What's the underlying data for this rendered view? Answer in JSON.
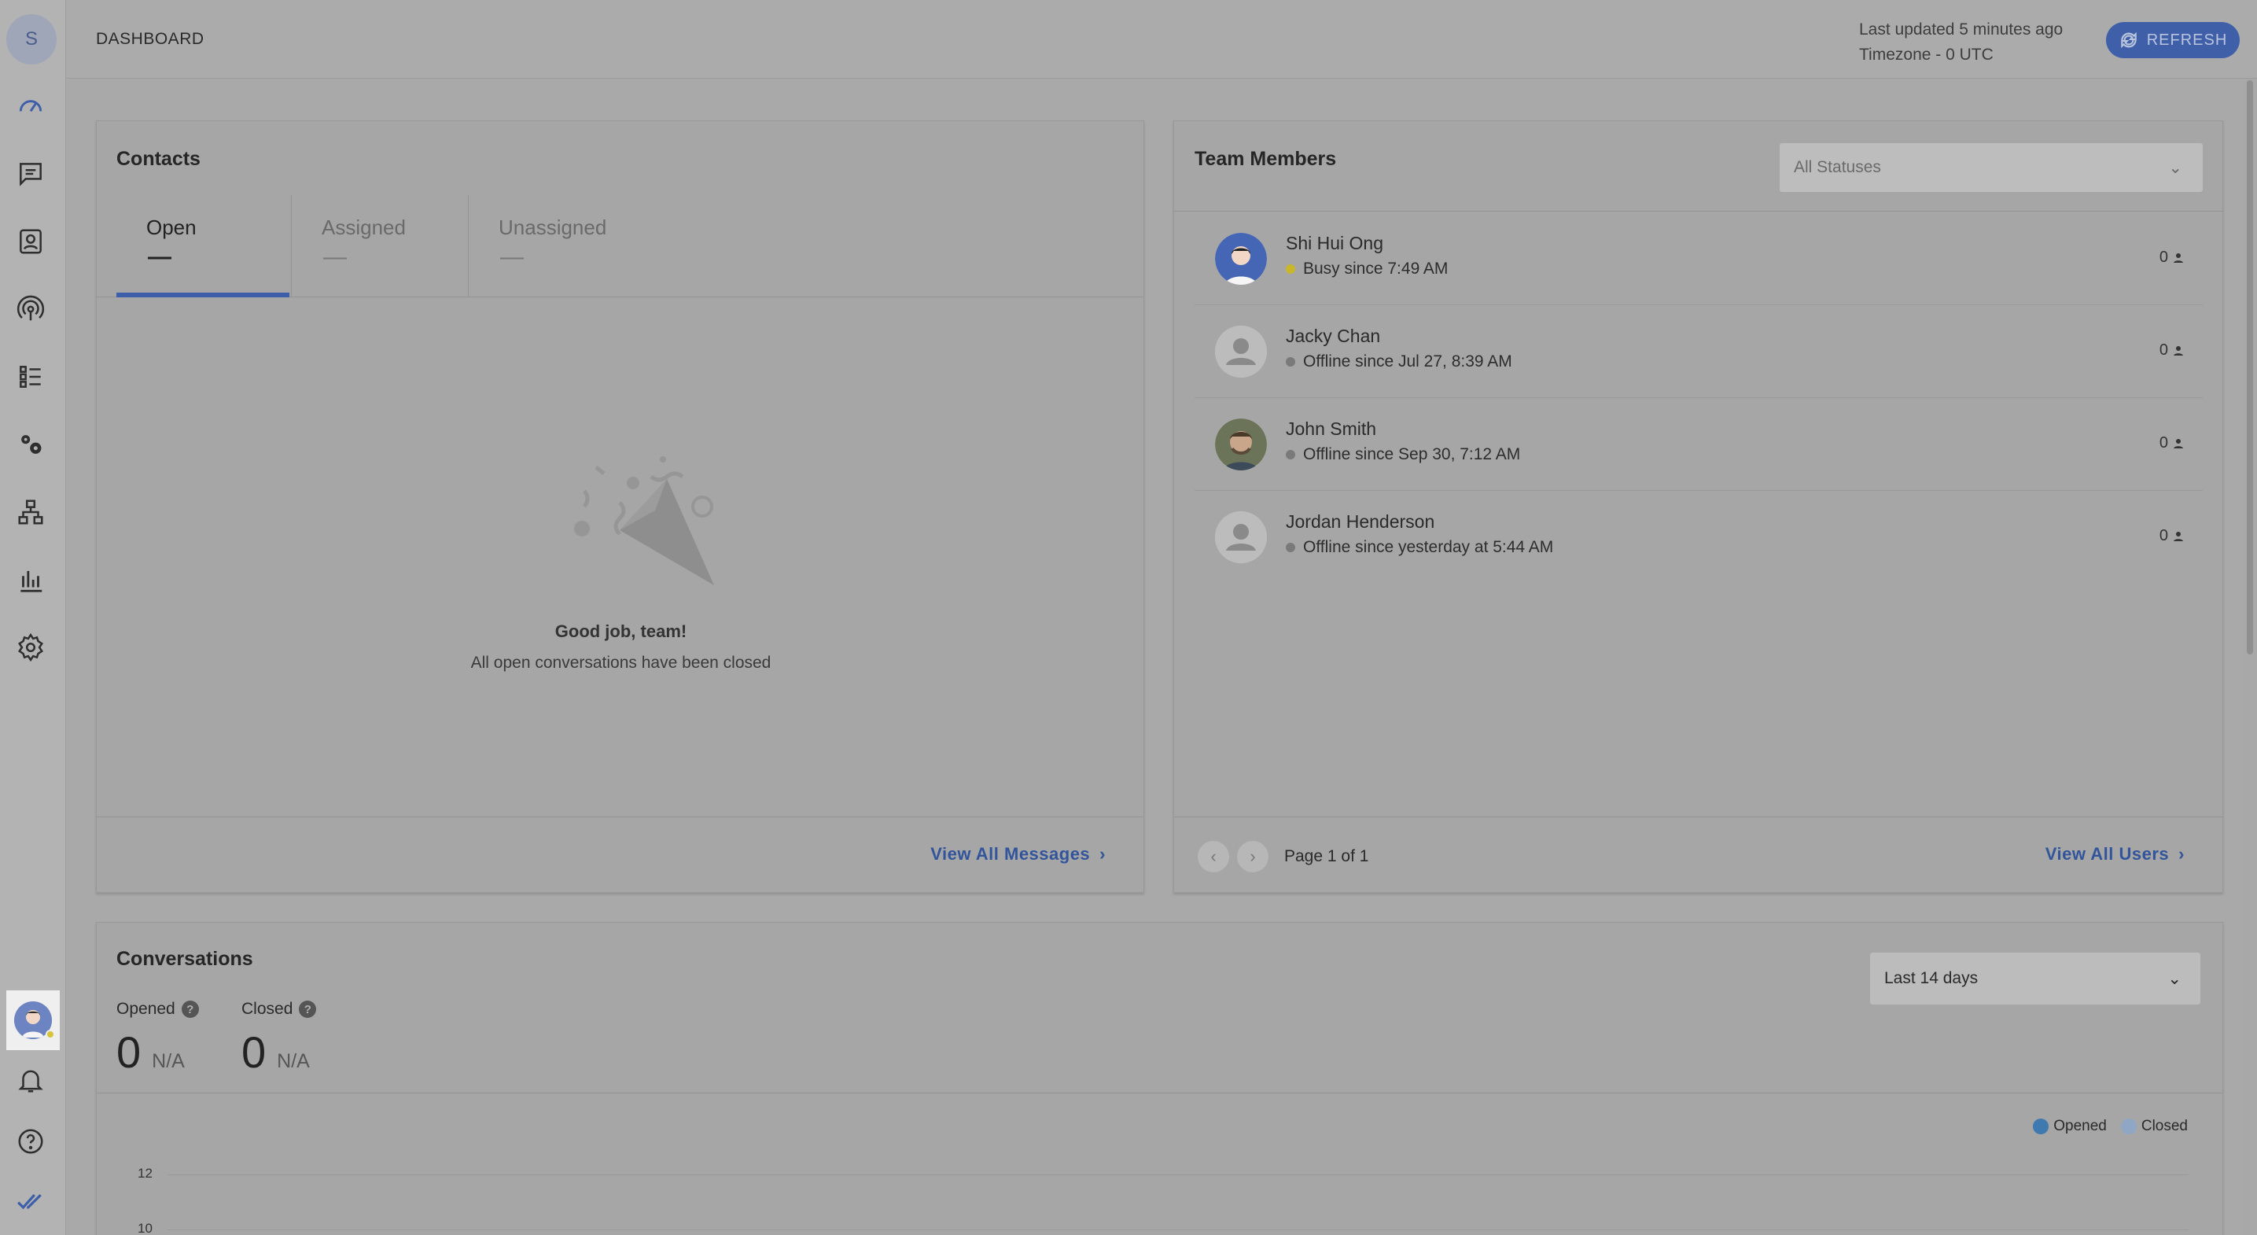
{
  "sidebar": {
    "org_initial": "S",
    "items": [
      "dashboard",
      "messages",
      "contacts",
      "broadcasts",
      "lists",
      "integrations",
      "workflows",
      "reports",
      "settings"
    ]
  },
  "header": {
    "title": "DASHBOARD",
    "last_updated": "Last updated 5 minutes ago",
    "timezone": "Timezone - 0 UTC",
    "refresh_label": "REFRESH"
  },
  "contacts": {
    "title": "Contacts",
    "tabs": [
      {
        "label": "Open",
        "value": "—",
        "active": true
      },
      {
        "label": "Assigned",
        "value": "—",
        "active": false
      },
      {
        "label": "Unassigned",
        "value": "—",
        "active": false
      }
    ],
    "empty_title": "Good job, team!",
    "empty_sub": "All open conversations have been closed",
    "footer_link": "View All Messages"
  },
  "team": {
    "title": "Team Members",
    "status_filter": "All Statuses",
    "members": [
      {
        "name": "Shi Hui Ong",
        "status": "Busy since 7:49 AM",
        "status_color": "#c9b72b",
        "count": "0"
      },
      {
        "name": "Jacky Chan",
        "status": "Offline since Jul 27, 8:39 AM",
        "status_color": "#7a7a7a",
        "count": "0"
      },
      {
        "name": "John Smith",
        "status": "Offline since Sep 30, 7:12 AM",
        "status_color": "#7a7a7a",
        "count": "0"
      },
      {
        "name": "Jordan Henderson",
        "status": "Offline since yesterday at 5:44 AM",
        "status_color": "#7a7a7a",
        "count": "0"
      }
    ],
    "page_info": "Page 1 of 1",
    "footer_link": "View All Users"
  },
  "conversations": {
    "title": "Conversations",
    "range": "Last 14 days",
    "metrics": [
      {
        "label": "Opened",
        "value": "0",
        "change": "N/A"
      },
      {
        "label": "Closed",
        "value": "0",
        "change": "N/A"
      }
    ],
    "legend": [
      {
        "label": "Opened",
        "color": "#3e79b0"
      },
      {
        "label": "Closed",
        "color": "#8fa7c4"
      }
    ],
    "y_ticks": [
      "12",
      "10"
    ]
  },
  "colors": {
    "accent": "#3d5ea8",
    "link": "#31549b"
  }
}
